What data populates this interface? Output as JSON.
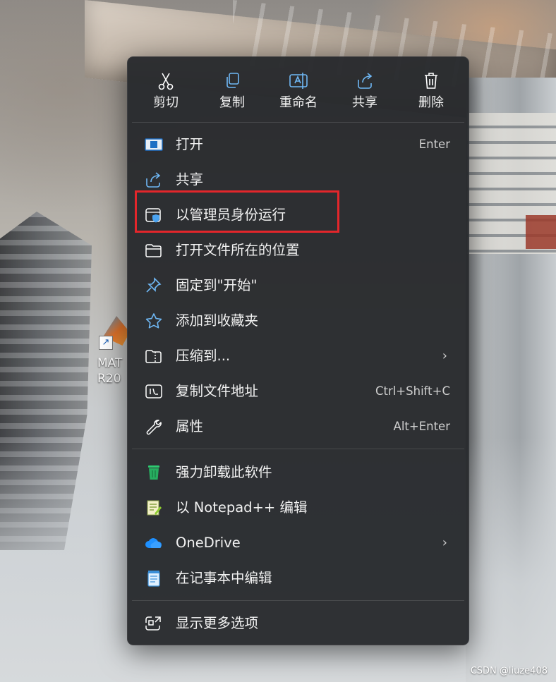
{
  "toolbar": {
    "cut": "剪切",
    "copy": "复制",
    "rename": "重命名",
    "share": "共享",
    "delete": "删除"
  },
  "menu": {
    "items": [
      {
        "label": "打开",
        "shortcut": "Enter",
        "icon": "open-app-icon"
      },
      {
        "label": "共享",
        "icon": "share-icon"
      },
      {
        "label": "以管理员身份运行",
        "icon": "admin-shield-icon"
      },
      {
        "label": "打开文件所在的位置",
        "icon": "folder-icon"
      },
      {
        "label": "固定到\"开始\"",
        "icon": "pin-icon"
      },
      {
        "label": "添加到收藏夹",
        "icon": "star-icon"
      },
      {
        "label": "压缩到...",
        "icon": "zip-folder-icon",
        "submenu": true
      },
      {
        "label": "复制文件地址",
        "shortcut": "Ctrl+Shift+C",
        "icon": "copy-path-icon"
      },
      {
        "label": "属性",
        "shortcut": "Alt+Enter",
        "icon": "wrench-icon"
      },
      {
        "label": "强力卸载此软件",
        "icon": "trash-green-icon"
      },
      {
        "label": "以 Notepad++ 编辑",
        "icon": "notepadpp-icon"
      },
      {
        "label": "OneDrive",
        "icon": "cloud-icon",
        "submenu": true
      },
      {
        "label": "在记事本中编辑",
        "icon": "notepad-icon"
      },
      {
        "label": "显示更多选项",
        "icon": "more-options-icon"
      }
    ],
    "submenu_glyph": "›"
  },
  "desktop": {
    "icon_label_line1": "MAT",
    "icon_label_line2": "R20"
  },
  "watermark": "CSDN @liuze408",
  "colors": {
    "menu_bg": "#282a2d",
    "accent_blue": "#4aa3f0",
    "highlight_red": "#e3262b"
  }
}
